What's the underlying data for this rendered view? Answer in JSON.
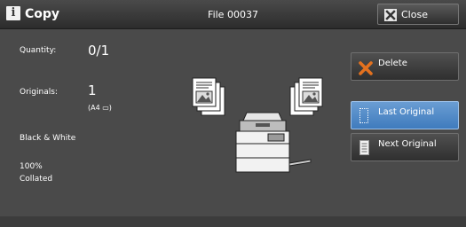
{
  "titlebar": {
    "app_title": "Copy",
    "file_title": "File 00037",
    "close_label": "Close",
    "info_icon_glyph": "i"
  },
  "info": {
    "quantity_label": "Quantity:",
    "quantity_value": "0/1",
    "originals_label": "Originals:",
    "originals_value": "1",
    "originals_size": "(A4 ▭)",
    "color_mode": "Black & White",
    "reduce_enlarge": "100%",
    "output": "Collated"
  },
  "actions": {
    "delete_label": "Delete",
    "last_original_label": "Last Original",
    "next_original_label": "Next Original"
  },
  "colors": {
    "background": "#4a4a4a",
    "accent_blue": "#4f87c6",
    "delete_orange": "#e3711f"
  }
}
